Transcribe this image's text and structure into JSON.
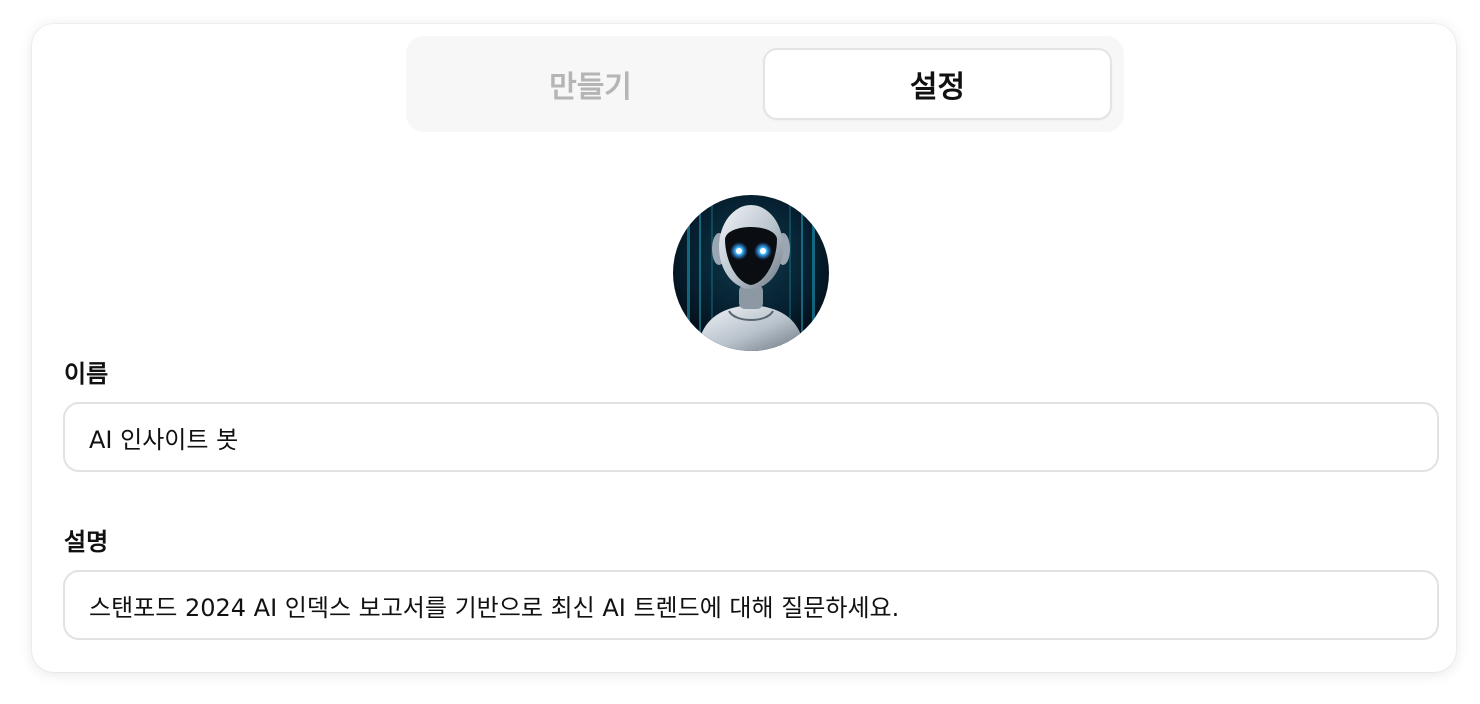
{
  "tabs": [
    {
      "label": "만들기",
      "active": false
    },
    {
      "label": "설정",
      "active": true
    }
  ],
  "avatar": {
    "icon": "robot-avatar"
  },
  "name_field": {
    "label": "이름",
    "value": "AI 인사이트 봇"
  },
  "description_field": {
    "label": "설명",
    "value": "스탠포드 2024 AI 인덱스 보고서를 기반으로 최신 AI 트렌드에 대해 질문하세요."
  },
  "colors": {
    "tab_active_text": "#111111",
    "tab_inactive_text": "#b5b5b5",
    "field_border": "#e2e2e2",
    "avatar_glow": "#3fb7ff"
  }
}
